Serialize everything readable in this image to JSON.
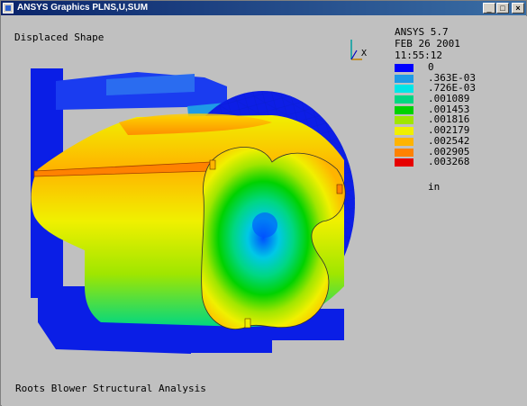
{
  "window": {
    "title": "ANSYS Graphics  PLNS,U,SUM"
  },
  "plot": {
    "subtitle": "Displaced Shape",
    "footer": "Roots Blower Structural Analysis",
    "program": "ANSYS 5.7",
    "date": "FEB 26 2001",
    "time": "11:55:12",
    "units": "in",
    "triad_axis_label": "X"
  },
  "legend": {
    "items": [
      {
        "value": "0",
        "color": "#0000ff"
      },
      {
        "value": ".363E-03",
        "color": "#1e9be6"
      },
      {
        "value": ".726E-03",
        "color": "#00e6e6"
      },
      {
        "value": ".001089",
        "color": "#00d782"
      },
      {
        "value": ".001453",
        "color": "#00d200"
      },
      {
        "value": ".001816",
        "color": "#a0e600"
      },
      {
        "value": ".002179",
        "color": "#f0f000"
      },
      {
        "value": ".002542",
        "color": "#ffb400"
      },
      {
        "value": ".002905",
        "color": "#ff8200"
      },
      {
        "value": ".003268",
        "color": "#e60000"
      }
    ]
  }
}
